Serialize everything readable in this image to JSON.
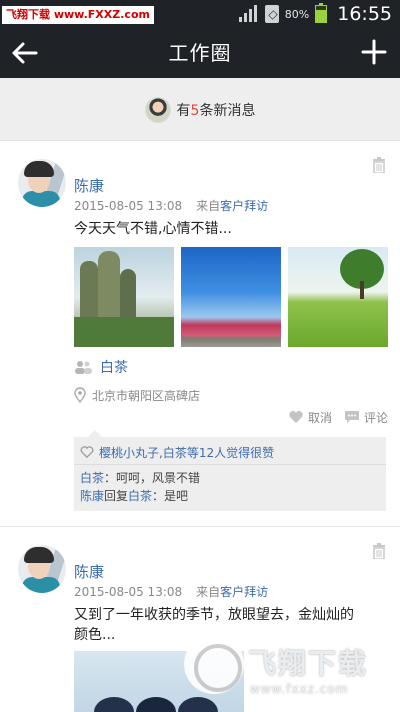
{
  "status_bar": {
    "watermark": "飞翔下载 www.FXXZ.com",
    "battery": "80%",
    "time": "16:55"
  },
  "nav": {
    "title": "工作圈",
    "back_icon": "arrow-left-icon",
    "add_icon": "plus-icon"
  },
  "notice": {
    "prefix": "有",
    "count": "5",
    "suffix": "条新消息"
  },
  "posts": [
    {
      "author": "陈康",
      "date": "2015-08-05 13:08",
      "from_label": "来自",
      "source": "客户拜访",
      "content": "今天天气不错,心情不错...",
      "mention": "白茶",
      "location": "北京市朝阳区高碑店",
      "actions": {
        "cancel": "取消",
        "comment": "评论"
      },
      "likes": "樱桃小丸子,白茶等12人觉得很赞",
      "comments": [
        {
          "name": "白茶",
          "text": "：呵呵，风景不错"
        },
        {
          "name": "陈康",
          "reply": "回复",
          "name2": "白茶",
          "text": "：是吧"
        }
      ]
    },
    {
      "author": "陈康",
      "date": "2015-08-05 13:08",
      "from_label": "来自",
      "source": "客户拜访",
      "content_line1": "又到了一年收获的季节，放眼望去，金灿灿的",
      "content_line2": "颜色..."
    }
  ],
  "watermark_bottom": {
    "text": "飞翔下载",
    "url": "www.fxxz.com"
  },
  "colors": {
    "topbar": "#1f2226",
    "link": "#3d6cab",
    "accent_red": "#e0453b",
    "notice_bg": "#eeeeee"
  }
}
